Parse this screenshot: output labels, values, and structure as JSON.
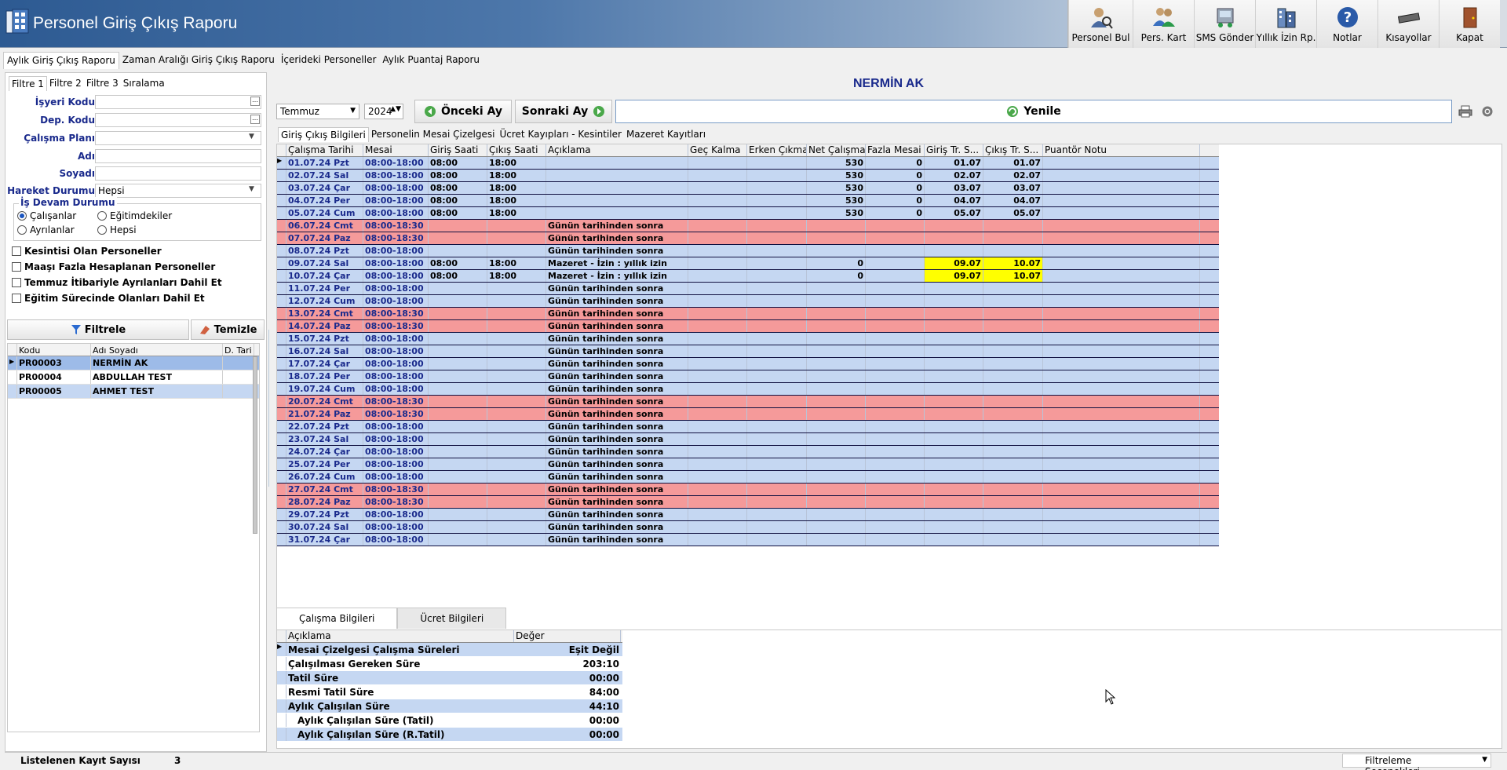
{
  "app": {
    "title": "Personel Giriş Çıkış Raporu"
  },
  "toolbar": [
    {
      "label": "Personel Bul",
      "icon": "person-search-icon"
    },
    {
      "label": "Pers. Kart",
      "icon": "people-icon"
    },
    {
      "label": "SMS Gönder",
      "icon": "sms-icon"
    },
    {
      "label": "Yıllık İzin Rp.",
      "icon": "building-icon"
    },
    {
      "label": "Notlar",
      "icon": "help-icon"
    },
    {
      "label": "Kısayollar",
      "icon": "keyboard-icon"
    },
    {
      "label": "Kapat",
      "icon": "exit-door-icon"
    }
  ],
  "main_tabs": [
    "Aylık Giriş Çıkış Raporu",
    "Zaman Aralığı Giriş Çıkış Raporu",
    "İçerideki Personeller",
    "Aylık Puantaj Raporu"
  ],
  "filter": {
    "tabs": [
      "Filtre 1",
      "Filtre 2",
      "Filtre 3",
      "Sıralama"
    ],
    "fields": {
      "isyeri_kodu": {
        "label": "İşyeri Kodu",
        "value": ""
      },
      "dep_kodu": {
        "label": "Dep. Kodu",
        "value": ""
      },
      "calisma_plani": {
        "label": "Çalışma Planı",
        "value": ""
      },
      "adi": {
        "label": "Adı",
        "value": ""
      },
      "soyadi": {
        "label": "Soyadı",
        "value": ""
      },
      "hareket_durumu": {
        "label": "Hareket Durumu",
        "value": "Hepsi"
      }
    },
    "is_devam": {
      "legend": "İş Devam Durumu",
      "options": [
        "Çalışanlar",
        "Eğitimdekiler",
        "Ayrılanlar",
        "Hepsi"
      ],
      "selected": "Çalışanlar"
    },
    "checkboxes": [
      "Kesintisi Olan Personeller",
      "Maaşı Fazla Hesaplanan Personeller",
      "Temmuz İtibariyle Ayrılanları Dahil Et",
      "Eğitim Sürecinde Olanları Dahil Et"
    ],
    "filter_button": "Filtrele",
    "clear_button": "Temizle"
  },
  "personnel": {
    "columns": [
      "Kodu",
      "Adı Soyadı",
      "D. Tari"
    ],
    "rows": [
      {
        "code": "PR00003",
        "name": "NERMİN AK",
        "selected": true
      },
      {
        "code": "PR00004",
        "name": "ABDULLAH TEST",
        "selected": false
      },
      {
        "code": "PR00005",
        "name": "AHMET TEST",
        "selected": false
      }
    ]
  },
  "status": {
    "label": "Listelenen Kayıt Sayısı",
    "count": "3",
    "filter_options": "Filtreleme Seçenekleri"
  },
  "report": {
    "person_name": "NERMİN AK",
    "month": "Temmuz",
    "year": "2024",
    "prev_button": "Önceki Ay",
    "next_button": "Sonraki Ay",
    "refresh_button": "Yenile"
  },
  "sub_tabs": [
    "Giriş Çıkış Bilgileri",
    "Personelin Mesai Çizelgesi",
    "Ücret Kayıpları - Kesintiler",
    "Mazeret Kayıtları"
  ],
  "grid": {
    "columns": [
      "Çalışma Tarihi",
      "Mesai",
      "Giriş Saati",
      "Çıkış Saati",
      "Açıklama",
      "Geç Kalma",
      "Erken Çıkma",
      "Net Çalışma",
      "Fazla Mesai",
      "Giriş Tr. S...",
      "Çıkış Tr. S...",
      "Puantör Notu"
    ],
    "rows": [
      {
        "date": "01.07.24 Pzt",
        "shift": "08:00-18:00",
        "in": "08:00",
        "out": "18:00",
        "desc": "",
        "net": "530",
        "extra": "0",
        "in_tr": "01.07",
        "out_tr": "01.07",
        "style": "blue"
      },
      {
        "date": "02.07.24 Sal",
        "shift": "08:00-18:00",
        "in": "08:00",
        "out": "18:00",
        "desc": "",
        "net": "530",
        "extra": "0",
        "in_tr": "02.07",
        "out_tr": "02.07",
        "style": "blue"
      },
      {
        "date": "03.07.24 Çar",
        "shift": "08:00-18:00",
        "in": "08:00",
        "out": "18:00",
        "desc": "",
        "net": "530",
        "extra": "0",
        "in_tr": "03.07",
        "out_tr": "03.07",
        "style": "blue"
      },
      {
        "date": "04.07.24 Per",
        "shift": "08:00-18:00",
        "in": "08:00",
        "out": "18:00",
        "desc": "",
        "net": "530",
        "extra": "0",
        "in_tr": "04.07",
        "out_tr": "04.07",
        "style": "blue"
      },
      {
        "date": "05.07.24 Cum",
        "shift": "08:00-18:00",
        "in": "08:00",
        "out": "18:00",
        "desc": "",
        "net": "530",
        "extra": "0",
        "in_tr": "05.07",
        "out_tr": "05.07",
        "style": "blue"
      },
      {
        "date": "06.07.24 Cmt",
        "shift": "08:00-18:30",
        "in": "",
        "out": "",
        "desc": "Günün tarihinden sonra",
        "net": "",
        "extra": "",
        "in_tr": "",
        "out_tr": "",
        "style": "red"
      },
      {
        "date": "07.07.24 Paz",
        "shift": "08:00-18:30",
        "in": "",
        "out": "",
        "desc": "Günün tarihinden sonra",
        "net": "",
        "extra": "",
        "in_tr": "",
        "out_tr": "",
        "style": "red"
      },
      {
        "date": "08.07.24 Pzt",
        "shift": "08:00-18:00",
        "in": "",
        "out": "",
        "desc": "Günün tarihinden sonra",
        "net": "",
        "extra": "",
        "in_tr": "",
        "out_tr": "",
        "style": "blue"
      },
      {
        "date": "09.07.24 Sal",
        "shift": "08:00-18:00",
        "in": "08:00",
        "out": "18:00",
        "desc": "Mazeret - İzin : yıllık izin",
        "net": "0",
        "extra": "",
        "in_tr": "09.07",
        "out_tr": "10.07",
        "style": "blue",
        "highlight": true
      },
      {
        "date": "10.07.24 Çar",
        "shift": "08:00-18:00",
        "in": "08:00",
        "out": "18:00",
        "desc": "Mazeret - İzin : yıllık izin",
        "net": "0",
        "extra": "",
        "in_tr": "09.07",
        "out_tr": "10.07",
        "style": "blue",
        "highlight": true
      },
      {
        "date": "11.07.24 Per",
        "shift": "08:00-18:00",
        "in": "",
        "out": "",
        "desc": "Günün tarihinden sonra",
        "net": "",
        "extra": "",
        "in_tr": "",
        "out_tr": "",
        "style": "blue"
      },
      {
        "date": "12.07.24 Cum",
        "shift": "08:00-18:00",
        "in": "",
        "out": "",
        "desc": "Günün tarihinden sonra",
        "net": "",
        "extra": "",
        "in_tr": "",
        "out_tr": "",
        "style": "blue"
      },
      {
        "date": "13.07.24 Cmt",
        "shift": "08:00-18:30",
        "in": "",
        "out": "",
        "desc": "Günün tarihinden sonra",
        "net": "",
        "extra": "",
        "in_tr": "",
        "out_tr": "",
        "style": "red"
      },
      {
        "date": "14.07.24 Paz",
        "shift": "08:00-18:30",
        "in": "",
        "out": "",
        "desc": "Günün tarihinden sonra",
        "net": "",
        "extra": "",
        "in_tr": "",
        "out_tr": "",
        "style": "red"
      },
      {
        "date": "15.07.24 Pzt",
        "shift": "08:00-18:00",
        "in": "",
        "out": "",
        "desc": "Günün tarihinden sonra",
        "net": "",
        "extra": "",
        "in_tr": "",
        "out_tr": "",
        "style": "blue"
      },
      {
        "date": "16.07.24 Sal",
        "shift": "08:00-18:00",
        "in": "",
        "out": "",
        "desc": "Günün tarihinden sonra",
        "net": "",
        "extra": "",
        "in_tr": "",
        "out_tr": "",
        "style": "blue"
      },
      {
        "date": "17.07.24 Çar",
        "shift": "08:00-18:00",
        "in": "",
        "out": "",
        "desc": "Günün tarihinden sonra",
        "net": "",
        "extra": "",
        "in_tr": "",
        "out_tr": "",
        "style": "blue"
      },
      {
        "date": "18.07.24 Per",
        "shift": "08:00-18:00",
        "in": "",
        "out": "",
        "desc": "Günün tarihinden sonra",
        "net": "",
        "extra": "",
        "in_tr": "",
        "out_tr": "",
        "style": "blue"
      },
      {
        "date": "19.07.24 Cum",
        "shift": "08:00-18:00",
        "in": "",
        "out": "",
        "desc": "Günün tarihinden sonra",
        "net": "",
        "extra": "",
        "in_tr": "",
        "out_tr": "",
        "style": "blue"
      },
      {
        "date": "20.07.24 Cmt",
        "shift": "08:00-18:30",
        "in": "",
        "out": "",
        "desc": "Günün tarihinden sonra",
        "net": "",
        "extra": "",
        "in_tr": "",
        "out_tr": "",
        "style": "red"
      },
      {
        "date": "21.07.24 Paz",
        "shift": "08:00-18:30",
        "in": "",
        "out": "",
        "desc": "Günün tarihinden sonra",
        "net": "",
        "extra": "",
        "in_tr": "",
        "out_tr": "",
        "style": "red"
      },
      {
        "date": "22.07.24 Pzt",
        "shift": "08:00-18:00",
        "in": "",
        "out": "",
        "desc": "Günün tarihinden sonra",
        "net": "",
        "extra": "",
        "in_tr": "",
        "out_tr": "",
        "style": "blue"
      },
      {
        "date": "23.07.24 Sal",
        "shift": "08:00-18:00",
        "in": "",
        "out": "",
        "desc": "Günün tarihinden sonra",
        "net": "",
        "extra": "",
        "in_tr": "",
        "out_tr": "",
        "style": "blue"
      },
      {
        "date": "24.07.24 Çar",
        "shift": "08:00-18:00",
        "in": "",
        "out": "",
        "desc": "Günün tarihinden sonra",
        "net": "",
        "extra": "",
        "in_tr": "",
        "out_tr": "",
        "style": "blue"
      },
      {
        "date": "25.07.24 Per",
        "shift": "08:00-18:00",
        "in": "",
        "out": "",
        "desc": "Günün tarihinden sonra",
        "net": "",
        "extra": "",
        "in_tr": "",
        "out_tr": "",
        "style": "blue"
      },
      {
        "date": "26.07.24 Cum",
        "shift": "08:00-18:00",
        "in": "",
        "out": "",
        "desc": "Günün tarihinden sonra",
        "net": "",
        "extra": "",
        "in_tr": "",
        "out_tr": "",
        "style": "blue"
      },
      {
        "date": "27.07.24 Cmt",
        "shift": "08:00-18:30",
        "in": "",
        "out": "",
        "desc": "Günün tarihinden sonra",
        "net": "",
        "extra": "",
        "in_tr": "",
        "out_tr": "",
        "style": "red"
      },
      {
        "date": "28.07.24 Paz",
        "shift": "08:00-18:30",
        "in": "",
        "out": "",
        "desc": "Günün tarihinden sonra",
        "net": "",
        "extra": "",
        "in_tr": "",
        "out_tr": "",
        "style": "red"
      },
      {
        "date": "29.07.24 Pzt",
        "shift": "08:00-18:00",
        "in": "",
        "out": "",
        "desc": "Günün tarihinden sonra",
        "net": "",
        "extra": "",
        "in_tr": "",
        "out_tr": "",
        "style": "blue"
      },
      {
        "date": "30.07.24 Sal",
        "shift": "08:00-18:00",
        "in": "",
        "out": "",
        "desc": "Günün tarihinden sonra",
        "net": "",
        "extra": "",
        "in_tr": "",
        "out_tr": "",
        "style": "blue"
      },
      {
        "date": "31.07.24 Çar",
        "shift": "08:00-18:00",
        "in": "",
        "out": "",
        "desc": "Günün tarihinden sonra",
        "net": "",
        "extra": "",
        "in_tr": "",
        "out_tr": "",
        "style": "blue"
      }
    ]
  },
  "bottom_tabs": [
    "Çalışma Bilgileri",
    "Ücret Bilgileri"
  ],
  "summary": {
    "columns": [
      "Açıklama",
      "Değer"
    ],
    "rows": [
      {
        "label": "Mesai Çizelgesi Çalışma Süreleri",
        "value": "Eşit Değil",
        "indent": false,
        "style": "blue"
      },
      {
        "label": "Çalışılması Gereken Süre",
        "value": "203:10",
        "indent": false,
        "style": "white"
      },
      {
        "label": "Tatil Süre",
        "value": "00:00",
        "indent": false,
        "style": "blue"
      },
      {
        "label": "Resmi Tatil Süre",
        "value": "84:00",
        "indent": false,
        "style": "white"
      },
      {
        "label": "Aylık Çalışılan Süre",
        "value": "44:10",
        "indent": false,
        "style": "blue"
      },
      {
        "label": "Aylık Çalışılan Süre (Tatil)",
        "value": "00:00",
        "indent": true,
        "style": "white"
      },
      {
        "label": "Aylık Çalışılan Süre (R.Tatil)",
        "value": "00:00",
        "indent": true,
        "style": "blue"
      }
    ]
  }
}
